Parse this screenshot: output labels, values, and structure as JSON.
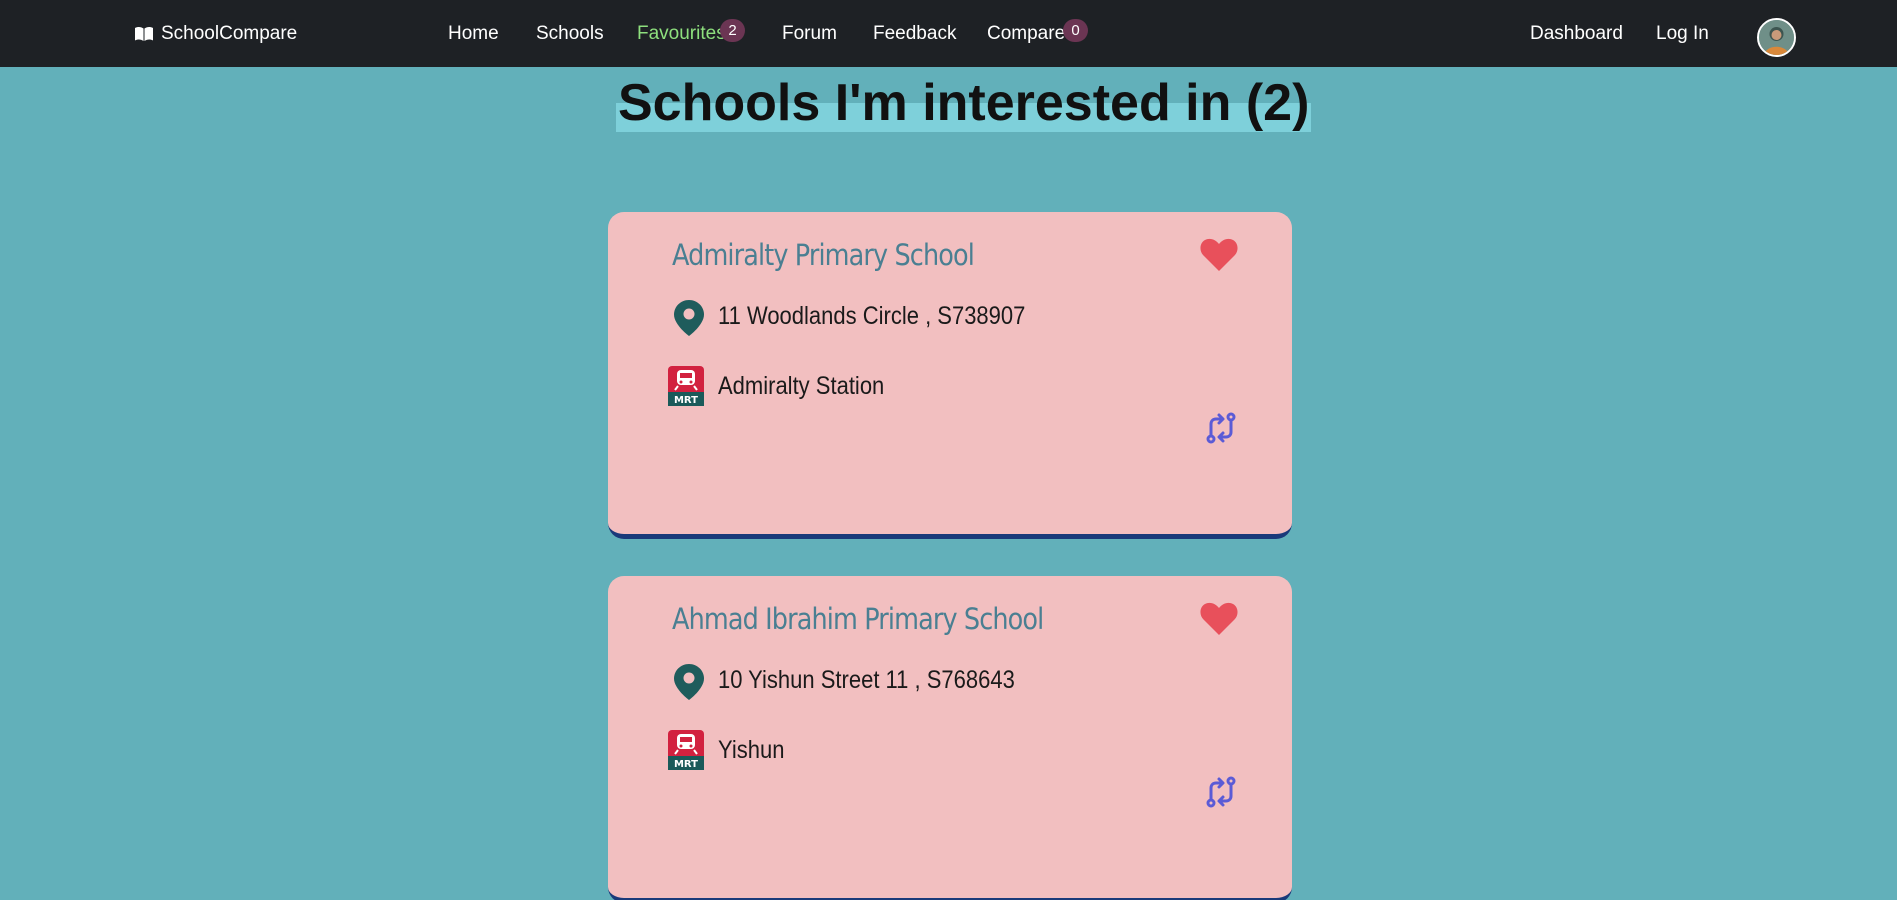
{
  "nav": {
    "brand": "SchoolCompare",
    "home": "Home",
    "schools": "Schools",
    "favourites": "Favourites",
    "favourites_count": "2",
    "forum": "Forum",
    "feedback": "Feedback",
    "compare": "Compare",
    "compare_count": "0",
    "dashboard": "Dashboard",
    "login": "Log In"
  },
  "page": {
    "title": "Schools I'm interested in (2)"
  },
  "schools": [
    {
      "name": "Admiralty Primary School",
      "address": "11 Woodlands Circle ,   S738907",
      "mrt": "Admiralty Station",
      "favourited": true
    },
    {
      "name": "Ahmad Ibrahim Primary School",
      "address": "10 Yishun Street 11 ,   S768643",
      "mrt": "Yishun",
      "favourited": true
    }
  ],
  "icons": {
    "brand": "open-book-icon",
    "heart": "heart-icon",
    "location": "map-pin-icon",
    "mrt": "mrt-train-icon",
    "compare": "compare-arrows-icon",
    "avatar": "user-avatar"
  },
  "colors": {
    "background": "#62b0ba",
    "navbar": "#1e2125",
    "active_link": "#8ee07e",
    "badge": "#6b3553",
    "card": "#f2bfc0",
    "card_border": "#1a3a7a",
    "school_name": "#4a7f92",
    "heart": "#e8505b",
    "pin": "#1f5c5c",
    "mrt_red": "#d2213f",
    "mrt_teal": "#1a5a5a",
    "compare": "#5b5bd6"
  }
}
